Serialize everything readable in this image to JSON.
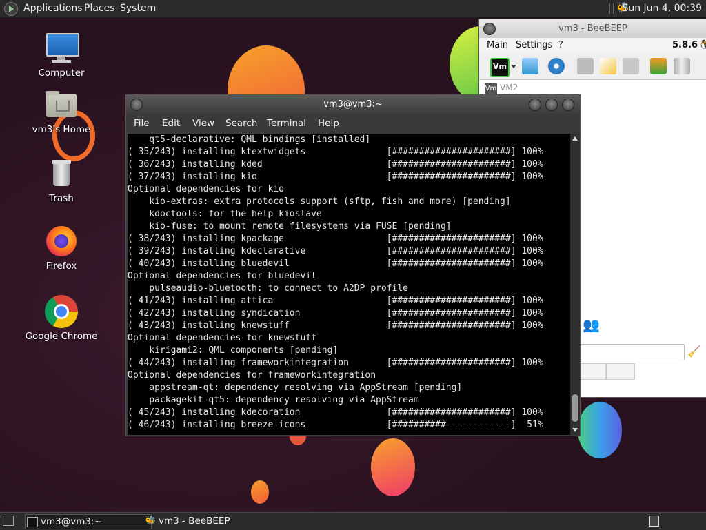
{
  "top_panel": {
    "menus": [
      "Applications",
      "Places",
      "System"
    ],
    "clock": "Sun Jun  4, 00:39"
  },
  "desktop": {
    "icons": [
      {
        "label": "Computer",
        "icon": "computer-icon"
      },
      {
        "label": "vm3's Home",
        "icon": "home-folder-icon"
      },
      {
        "label": "Trash",
        "icon": "trash-icon"
      },
      {
        "label": "Firefox",
        "icon": "firefox-icon"
      },
      {
        "label": "Google Chrome",
        "icon": "chrome-icon"
      }
    ]
  },
  "terminal": {
    "title": "vm3@vm3:~",
    "menu": [
      "File",
      "Edit",
      "View",
      "Search",
      "Terminal",
      "Help"
    ],
    "lines": [
      "    qt5-declarative: QML bindings [installed]",
      "( 35/243) installing ktextwidgets               [######################] 100%",
      "( 36/243) installing kded                       [######################] 100%",
      "( 37/243) installing kio                        [######################] 100%",
      "Optional dependencies for kio",
      "    kio-extras: extra protocols support (sftp, fish and more) [pending]",
      "    kdoctools: for the help kioslave",
      "    kio-fuse: to mount remote filesystems via FUSE [pending]",
      "( 38/243) installing kpackage                   [######################] 100%",
      "( 39/243) installing kdeclarative               [######################] 100%",
      "( 40/243) installing bluedevil                  [######################] 100%",
      "Optional dependencies for bluedevil",
      "    pulseaudio-bluetooth: to connect to A2DP profile",
      "( 41/243) installing attica                     [######################] 100%",
      "( 42/243) installing syndication                [######################] 100%",
      "( 43/243) installing knewstuff                  [######################] 100%",
      "Optional dependencies for knewstuff",
      "    kirigami2: QML components [pending]",
      "( 44/243) installing frameworkintegration       [######################] 100%",
      "Optional dependencies for frameworkintegration",
      "    appstream-qt: dependency resolving via AppStream [pending]",
      "    packagekit-qt5: dependency resolving via AppStream",
      "( 45/243) installing kdecoration                [######################] 100%",
      "( 46/243) installing breeze-icons               [##########------------]  51%"
    ]
  },
  "beebeep": {
    "title": "vm3 - BeeBEEP",
    "menu": [
      "Main",
      "Settings",
      "?"
    ],
    "version": "5.8.6",
    "vm_badge": "Vm",
    "user_list_item": "VM2"
  },
  "taskbar": {
    "tasks": [
      "vm3@vm3:~",
      "vm3 - BeeBEEP"
    ]
  }
}
